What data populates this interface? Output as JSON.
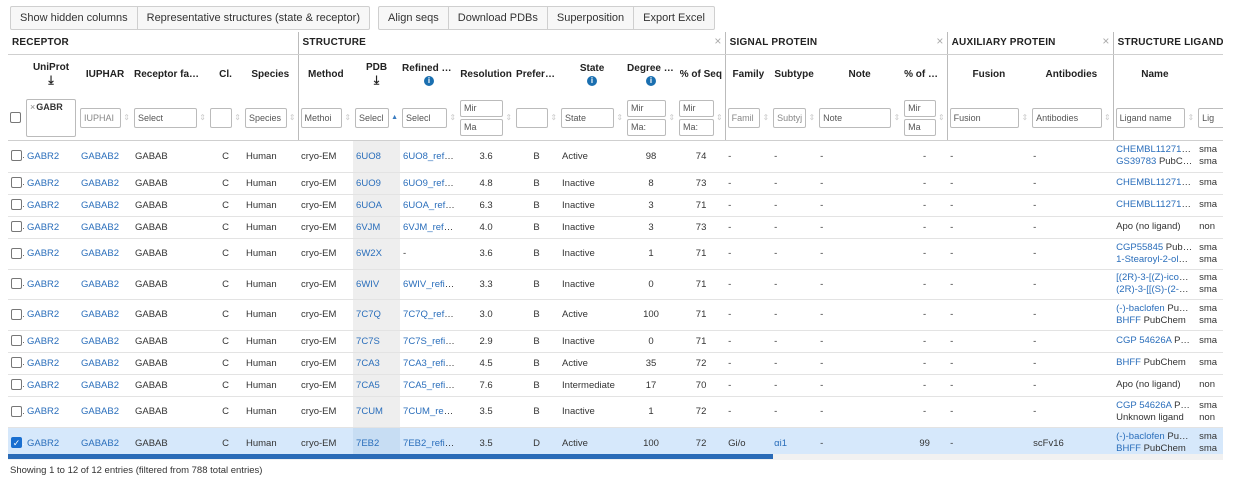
{
  "toolbar": {
    "show_hidden_columns": "Show hidden columns",
    "representative_structures": "Representative structures (state & receptor)",
    "align_seqs": "Align seqs",
    "download_pdbs": "Download PDBs",
    "superposition": "Superposition",
    "export_excel": "Export Excel"
  },
  "groups": {
    "receptor": "RECEPTOR",
    "structure": "STRUCTURE",
    "signal_protein": "SIGNAL PROTEIN",
    "auxiliary_protein": "AUXILIARY PROTEIN",
    "structure_ligand": "STRUCTURE LIGAND",
    "close": "×"
  },
  "headers": {
    "uniprot": "UniProt",
    "iuphar": "IUPHAR",
    "receptor_family": "Receptor family",
    "cl": "Cl.",
    "species": "Species",
    "method": "Method",
    "pdb": "PDB",
    "refined_structure": "Refined structure",
    "resolution": "Resolution",
    "preferred_chain": "Preferred chain",
    "state": "State",
    "degree_active": "Degree active (%)",
    "pct_seq": "% of Seq",
    "family": "Family",
    "subtype": "Subtype",
    "note": "Note",
    "pct_seq2": "% of Seq",
    "fusion": "Fusion",
    "antibodies": "Antibodies",
    "ligand_name": "Name"
  },
  "filters": {
    "uniprot_chip": "GABR",
    "iuphar": "IUPHAI",
    "family": "Select",
    "species": "Species",
    "method": "Methoi",
    "pdb": "Selecl",
    "refined": "Selecl",
    "res_min": "Mir",
    "res_max": "Ma",
    "state": "State",
    "deg_min": "Mir",
    "deg_max": "Ma:",
    "seq_min": "Mir",
    "seq_max": "Ma:",
    "sig_family": "Famil",
    "subtype": "Subtyj",
    "note": "Note",
    "seq2_min": "Mir",
    "seq2_max": "Ma",
    "fusion": "Fusion",
    "antibodies": "Antibodies",
    "ligand_name": "Ligand name",
    "ligand_type": "Lig"
  },
  "rows": [
    {
      "uniprot": "GABR2",
      "iuphar": "GABAB2",
      "family": "GABAB",
      "cl": "C",
      "species": "Human",
      "method": "cryo-EM",
      "pdb": "6UO8",
      "refined": "6UO8_refined",
      "resolution": "3.6",
      "chain": "B",
      "state": "Active",
      "degree": "98",
      "seq": "74",
      "sig_family": "-",
      "subtype": "-",
      "note": "-",
      "seq2": "-",
      "fusion": "-",
      "antibodies": "-",
      "ligands": [
        {
          "name": "CHEMBL112710 ...",
          "type": "sma"
        },
        {
          "name": "GS39783",
          "src": "PubChe...",
          "type": "sma"
        }
      ]
    },
    {
      "uniprot": "GABR2",
      "iuphar": "GABAB2",
      "family": "GABAB",
      "cl": "C",
      "species": "Human",
      "method": "cryo-EM",
      "pdb": "6UO9",
      "refined": "6UO9_refined",
      "resolution": "4.8",
      "chain": "B",
      "state": "Inactive",
      "degree": "8",
      "seq": "73",
      "sig_family": "-",
      "subtype": "-",
      "note": "-",
      "seq2": "-",
      "fusion": "-",
      "antibodies": "-",
      "ligands": [
        {
          "name": "CHEMBL112710 ...",
          "type": "sma"
        }
      ]
    },
    {
      "uniprot": "GABR2",
      "iuphar": "GABAB2",
      "family": "GABAB",
      "cl": "C",
      "species": "Human",
      "method": "cryo-EM",
      "pdb": "6UOA",
      "refined": "6UOA_refined",
      "resolution": "6.3",
      "chain": "B",
      "state": "Inactive",
      "degree": "3",
      "seq": "71",
      "sig_family": "-",
      "subtype": "-",
      "note": "-",
      "seq2": "-",
      "fusion": "-",
      "antibodies": "-",
      "ligands": [
        {
          "name": "CHEMBL112710 ...",
          "type": "sma"
        }
      ]
    },
    {
      "uniprot": "GABR2",
      "iuphar": "GABAB2",
      "family": "GABAB",
      "cl": "C",
      "species": "Human",
      "method": "cryo-EM",
      "pdb": "6VJM",
      "refined": "6VJM_refined",
      "resolution": "4.0",
      "chain": "B",
      "state": "Inactive",
      "degree": "3",
      "seq": "73",
      "sig_family": "-",
      "subtype": "-",
      "note": "-",
      "seq2": "-",
      "fusion": "-",
      "antibodies": "-",
      "ligands": [
        {
          "name": "Apo (no ligand)",
          "plain": true,
          "type": "non"
        }
      ]
    },
    {
      "uniprot": "GABR2",
      "iuphar": "GABAB2",
      "family": "GABAB",
      "cl": "C",
      "species": "Human",
      "method": "cryo-EM",
      "pdb": "6W2X",
      "refined": "-",
      "resolution": "3.6",
      "chain": "B",
      "state": "Inactive",
      "degree": "1",
      "seq": "71",
      "sig_family": "-",
      "subtype": "-",
      "note": "-",
      "seq2": "-",
      "fusion": "-",
      "antibodies": "-",
      "ligands": [
        {
          "name": "CGP55845",
          "src": "PubC...",
          "type": "sma"
        },
        {
          "name": "1-Stearoyl-2-oleo...",
          "type": "sma"
        }
      ]
    },
    {
      "uniprot": "GABR2",
      "iuphar": "GABAB2",
      "family": "GABAB",
      "cl": "C",
      "species": "Human",
      "method": "cryo-EM",
      "pdb": "6WIV",
      "refined": "6WIV_refined",
      "resolution": "3.3",
      "chain": "B",
      "state": "Inactive",
      "degree": "0",
      "seq": "71",
      "sig_family": "-",
      "subtype": "-",
      "note": "-",
      "seq2": "-",
      "fusion": "-",
      "antibodies": "-",
      "ligands": [
        {
          "name": "[(2R)-3-[(Z)-icos-1...",
          "type": "sma"
        },
        {
          "name": "(2R)-3-[[(S)-(2-am...",
          "type": "sma"
        }
      ]
    },
    {
      "uniprot": "GABR2",
      "iuphar": "GABAB2",
      "family": "GABAB",
      "cl": "C",
      "species": "Human",
      "method": "cryo-EM",
      "pdb": "7C7Q",
      "refined": "7C7Q_refined",
      "resolution": "3.0",
      "chain": "B",
      "state": "Active",
      "degree": "100",
      "seq": "71",
      "sig_family": "-",
      "subtype": "-",
      "note": "-",
      "seq2": "-",
      "fusion": "-",
      "antibodies": "-",
      "ligands": [
        {
          "name": "(-)-baclofen",
          "src": "PubC...",
          "type": "sma"
        },
        {
          "name": "BHFF",
          "src": "PubChem",
          "type": "sma"
        }
      ]
    },
    {
      "uniprot": "GABR2",
      "iuphar": "GABAB2",
      "family": "GABAB",
      "cl": "C",
      "species": "Human",
      "method": "cryo-EM",
      "pdb": "7C7S",
      "refined": "7C7S_refined",
      "resolution": "2.9",
      "chain": "B",
      "state": "Inactive",
      "degree": "0",
      "seq": "71",
      "sig_family": "-",
      "subtype": "-",
      "note": "-",
      "seq2": "-",
      "fusion": "-",
      "antibodies": "-",
      "ligands": [
        {
          "name": "CGP 54626A",
          "src": "Pub...",
          "type": "sma"
        }
      ]
    },
    {
      "uniprot": "GABR2",
      "iuphar": "GABAB2",
      "family": "GABAB",
      "cl": "C",
      "species": "Human",
      "method": "cryo-EM",
      "pdb": "7CA3",
      "refined": "7CA3_refined",
      "resolution": "4.5",
      "chain": "B",
      "state": "Active",
      "degree": "35",
      "seq": "72",
      "sig_family": "-",
      "subtype": "-",
      "note": "-",
      "seq2": "-",
      "fusion": "-",
      "antibodies": "-",
      "ligands": [
        {
          "name": "BHFF",
          "src": "PubChem",
          "type": "sma"
        }
      ]
    },
    {
      "uniprot": "GABR2",
      "iuphar": "GABAB2",
      "family": "GABAB",
      "cl": "C",
      "species": "Human",
      "method": "cryo-EM",
      "pdb": "7CA5",
      "refined": "7CA5_refined",
      "resolution": "7.6",
      "chain": "B",
      "state": "Intermediate",
      "degree": "17",
      "seq": "70",
      "sig_family": "-",
      "subtype": "-",
      "note": "-",
      "seq2": "-",
      "fusion": "-",
      "antibodies": "-",
      "ligands": [
        {
          "name": "Apo (no ligand)",
          "plain": true,
          "type": "non"
        }
      ]
    },
    {
      "uniprot": "GABR2",
      "iuphar": "GABAB2",
      "family": "GABAB",
      "cl": "C",
      "species": "Human",
      "method": "cryo-EM",
      "pdb": "7CUM",
      "refined": "7CUM_refined",
      "resolution": "3.5",
      "chain": "B",
      "state": "Inactive",
      "degree": "1",
      "seq": "72",
      "sig_family": "-",
      "subtype": "-",
      "note": "-",
      "seq2": "-",
      "fusion": "-",
      "antibodies": "-",
      "ligands": [
        {
          "name": "CGP 54626A",
          "src": "Pub...",
          "type": "sma"
        },
        {
          "name": "Unknown ligand",
          "plain": true,
          "type": "non"
        }
      ]
    },
    {
      "uniprot": "GABR2",
      "iuphar": "GABAB2",
      "family": "GABAB",
      "cl": "C",
      "species": "Human",
      "method": "cryo-EM",
      "pdb": "7EB2",
      "refined": "7EB2_refined",
      "resolution": "3.5",
      "chain": "D",
      "state": "Active",
      "degree": "100",
      "seq": "72",
      "sig_family": "Gi/o",
      "subtype": "αi1",
      "note": "-",
      "seq2": "99",
      "fusion": "-",
      "antibodies": "scFv16",
      "selected": true,
      "ligands": [
        {
          "name": "(-)-baclofen",
          "src": "PubC...",
          "type": "sma"
        },
        {
          "name": "BHFF",
          "src": "PubChem",
          "type": "sma"
        }
      ]
    }
  ],
  "scroll": {
    "position_fraction": 0.63
  },
  "footer": {
    "info": "Showing 1 to 12 of 12 entries (filtered from 788 total entries)"
  },
  "colors": {
    "link": "#2a6ebb",
    "selected_row": "#d6e8fb",
    "pdb_column": "#eeeeee",
    "scrollbar": "#2a6bb7",
    "info_icon": "#1a6fb0"
  }
}
